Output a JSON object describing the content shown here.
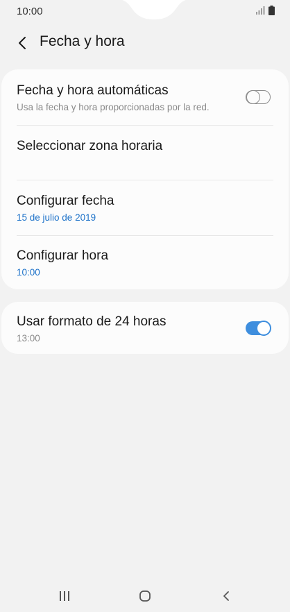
{
  "status_bar": {
    "time": "10:00",
    "icons": [
      "signal-icon",
      "battery-icon"
    ]
  },
  "header": {
    "title": "Fecha y hora",
    "back_icon": "chevron-left-icon"
  },
  "settings": {
    "auto_datetime": {
      "title": "Fecha y hora automáticas",
      "subtitle": "Usa la fecha y hora proporcionadas por la red.",
      "enabled": false
    },
    "timezone": {
      "title": "Seleccionar zona horaria"
    },
    "date": {
      "title": "Configurar fecha",
      "value": "15 de julio de 2019"
    },
    "time": {
      "title": "Configurar hora",
      "value": "10:00"
    },
    "format24": {
      "title": "Usar formato de 24 horas",
      "subtitle": "13:00",
      "enabled": true
    }
  },
  "colors": {
    "accent": "#1d72c9",
    "toggle_on": "#3e8ede",
    "background": "#f2f2f2",
    "card": "#fcfcfc"
  },
  "nav_bar": {
    "icons": [
      "recent-apps-icon",
      "home-icon",
      "back-icon"
    ]
  }
}
